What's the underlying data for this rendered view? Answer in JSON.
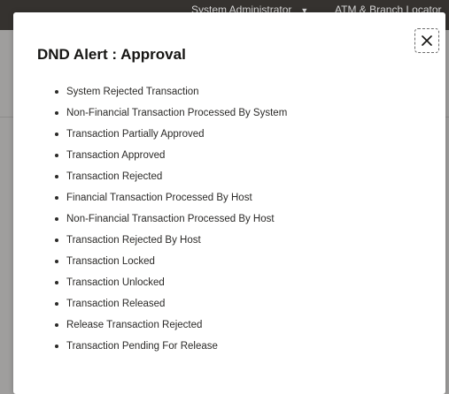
{
  "header": {
    "user_menu_label": "System Administrator",
    "atm_branch_locator_label": "ATM & Branch Locator"
  },
  "modal": {
    "title": "DND Alert : Approval",
    "close_icon": "close-icon",
    "items": [
      "System Rejected Transaction",
      "Non-Financial Transaction Processed By System",
      "Transaction Partially Approved",
      "Transaction Approved",
      "Transaction Rejected",
      "Financial Transaction Processed By Host",
      "Non-Financial Transaction Processed By Host",
      "Transaction Rejected By Host",
      "Transaction Locked",
      "Transaction Unlocked",
      "Transaction Released",
      "Release Transaction Rejected",
      "Transaction Pending For Release"
    ]
  }
}
